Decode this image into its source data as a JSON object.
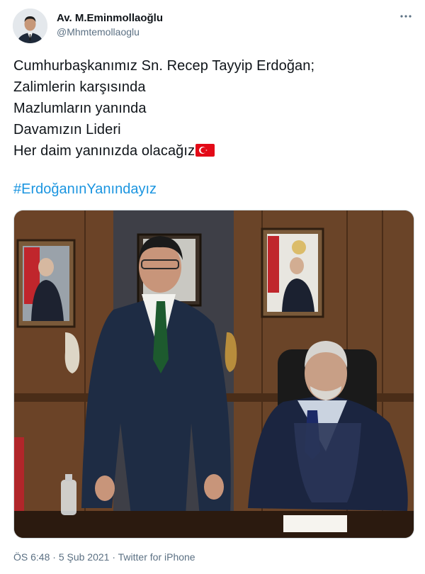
{
  "user": {
    "display_name": "Av. M.Eminmollaoğlu",
    "handle": "@Mhmtemollaoglu"
  },
  "tweet": {
    "lines": [
      "Cumhurbaşkanımız Sn. Recep Tayyip Erdoğan;",
      "Zalimlerin karşısında",
      "Mazlumların yanında",
      "Davamızın Lideri",
      "Her daim yanınızda olacağız"
    ],
    "hashtag": "#ErdoğanınYanındayız"
  },
  "meta": {
    "time": "ÖS 6:48",
    "separator1": " · ",
    "date": "5 Şub 2021",
    "separator2": " · ",
    "source": "Twitter for iPhone"
  },
  "colors": {
    "hashtag": "#1b95e0",
    "secondary_text": "#5b7083",
    "flag_red": "#e30a17"
  },
  "icons": [
    "more-options-icon",
    "turkish-flag-icon"
  ]
}
